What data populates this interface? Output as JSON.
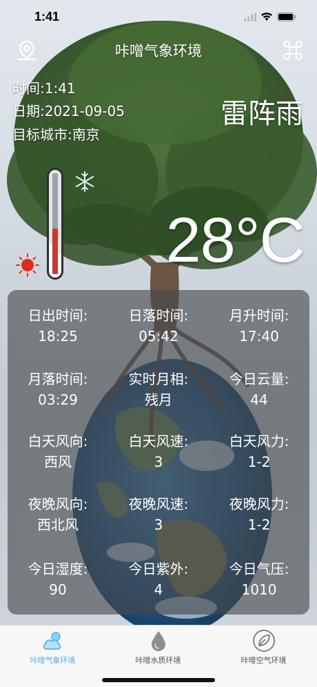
{
  "status_bar": {
    "time": "1:41"
  },
  "nav": {
    "title": "咔噌气象环境",
    "left_icon": "location-pin-icon",
    "right_icon": "command-icon"
  },
  "info": {
    "time": "时间:1:41",
    "date": "日期:2021-09-05",
    "city": "目标城市:南京"
  },
  "weather": {
    "condition": "雷阵雨",
    "temperature": "28°C",
    "thermometer_level": 0.45
  },
  "details": [
    {
      "label": "日出时间:",
      "value": "18:25"
    },
    {
      "label": "日落时间:",
      "value": "05:42"
    },
    {
      "label": "月升时间:",
      "value": "17:40"
    },
    {
      "label": "月落时间:",
      "value": "03:29"
    },
    {
      "label": "实时月相:",
      "value": "残月"
    },
    {
      "label": "今日云量:",
      "value": "44"
    },
    {
      "label": "白天风向:",
      "value": "西风"
    },
    {
      "label": "白天风速:",
      "value": "3"
    },
    {
      "label": "白天风力:",
      "value": "1-2"
    },
    {
      "label": "夜晚风向:",
      "value": "西北风"
    },
    {
      "label": "夜晚风速:",
      "value": "3"
    },
    {
      "label": "夜晚风力:",
      "value": "1-2"
    },
    {
      "label": "今日湿度:",
      "value": "90"
    },
    {
      "label": "今日紫外:",
      "value": "4"
    },
    {
      "label": "今日气压:",
      "value": "1010"
    }
  ],
  "tabs": [
    {
      "label": "咔噌气象环境",
      "icon": "cloud-sun-icon",
      "active": true
    },
    {
      "label": "咔噌水质环境",
      "icon": "water-drop-icon",
      "active": false
    },
    {
      "label": "咔噌空气环境",
      "icon": "leaf-icon",
      "active": false
    }
  ],
  "colors": {
    "accent": "#53b2e6",
    "thermometer_fill": "#c53a32",
    "panel": "#46484c"
  }
}
